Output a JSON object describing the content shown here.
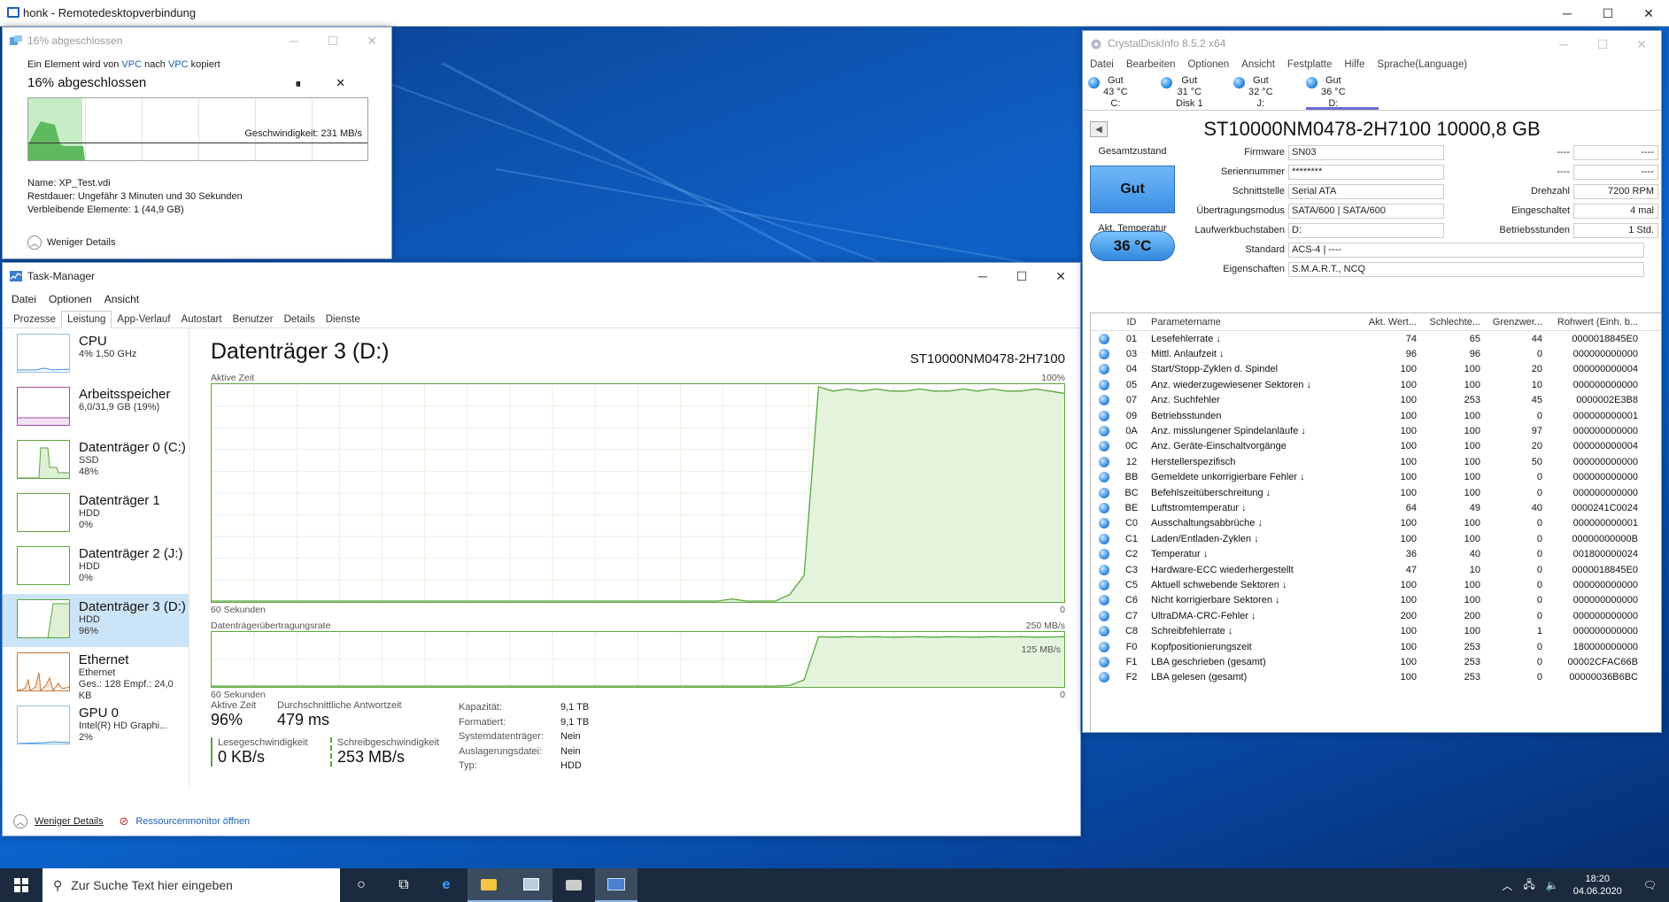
{
  "rdp": {
    "title": "honk - Remotedesktopverbindung"
  },
  "copy": {
    "title": "16% abgeschlossen",
    "line_prefix": "Ein Element wird von ",
    "src": "VPC",
    "mid": " nach ",
    "dst": "VPC",
    "suffix": " kopiert",
    "percent": "16% abgeschlossen",
    "speed": "Geschwindigkeit: 231 MB/s",
    "progress": 0.16,
    "name": "Name:  XP_Test.vdi",
    "remaining": "Restdauer:  Ungefähr 3 Minuten und 30 Sekunden",
    "items": "Verbleibende Elemente:  1 (44,9 GB)",
    "fewer": "Weniger Details"
  },
  "tm": {
    "title": "Task-Manager",
    "menu": [
      "Datei",
      "Optionen",
      "Ansicht"
    ],
    "tabs": [
      "Prozesse",
      "Leistung",
      "App-Verlauf",
      "Autostart",
      "Benutzer",
      "Details",
      "Dienste"
    ],
    "sidebar": [
      {
        "name": "CPU",
        "sub1": "4% 1,50 GHz",
        "sub2": "",
        "sub3": "",
        "color": "cpu"
      },
      {
        "name": "Arbeitsspeicher",
        "sub1": "6,0/31,9 GB (19%)",
        "sub2": "",
        "sub3": "",
        "color": "mem"
      },
      {
        "name": "Datenträger 0 (C:)",
        "sub1": "SSD",
        "sub2": "48%",
        "sub3": "",
        "color": "disk"
      },
      {
        "name": "Datenträger 1",
        "sub1": "HDD",
        "sub2": "0%",
        "sub3": "",
        "color": "disk"
      },
      {
        "name": "Datenträger 2 (J:)",
        "sub1": "HDD",
        "sub2": "0%",
        "sub3": "",
        "color": "disk"
      },
      {
        "name": "Datenträger 3 (D:)",
        "sub1": "HDD",
        "sub2": "96%",
        "sub3": "",
        "color": "disk"
      },
      {
        "name": "Ethernet",
        "sub1": "Ethernet",
        "sub2": "Ges.: 128 Empf.: 24,0 KB",
        "sub3": "",
        "color": "net"
      },
      {
        "name": "GPU 0",
        "sub1": "Intel(R) HD Graphi...",
        "sub2": "2%",
        "sub3": "",
        "color": "gpu"
      }
    ],
    "heading": "Datenträger 3 (D:)",
    "model": "ST10000NM0478-2H7100",
    "chart1": {
      "label": "Aktive Zeit",
      "max": "100%",
      "xl": "60 Sekunden",
      "xr": "0"
    },
    "chart2": {
      "label": "Datenträgerübertragungsrate",
      "max": "250 MB/s",
      "mid": "125 MB/s",
      "xl": "60 Sekunden",
      "xr": "0"
    },
    "active_time_series": [
      0,
      0,
      0,
      0,
      0,
      0,
      0,
      0,
      0,
      0,
      0,
      0,
      0,
      0,
      0,
      0,
      0,
      0,
      0,
      0,
      0,
      0,
      0,
      0,
      0,
      0,
      0,
      0,
      0,
      0,
      0,
      0,
      0,
      0,
      0,
      0,
      1,
      0,
      0,
      0,
      3,
      12,
      100,
      98,
      99,
      98,
      99,
      98,
      98,
      99,
      98,
      98,
      99,
      98,
      99,
      98,
      98,
      99,
      98,
      97
    ],
    "transfer_series": [
      0,
      0,
      0,
      0,
      0,
      0,
      0,
      0,
      0,
      0,
      0,
      0,
      0,
      0,
      0,
      0,
      0,
      0,
      0,
      0,
      0,
      0,
      0,
      0,
      0,
      0,
      0,
      0,
      0,
      0,
      0,
      0,
      0,
      0,
      0,
      0,
      0,
      0,
      0,
      0,
      3,
      30,
      240,
      238,
      240,
      239,
      240,
      238,
      239,
      240,
      238,
      240,
      239,
      238,
      240,
      239,
      240,
      238,
      239,
      240
    ],
    "stats": {
      "active_lbl": "Aktive Zeit",
      "active_val": "96%",
      "resp_lbl": "Durchschnittliche Antwortzeit",
      "resp_val": "479 ms",
      "read_lbl": "Lesegeschwindigkeit",
      "read_val": "0 KB/s",
      "write_lbl": "Schreibgeschwindigkeit",
      "write_val": "253 MB/s"
    },
    "kv": [
      {
        "k": "Kapazität:",
        "v": "9,1 TB"
      },
      {
        "k": "Formatiert:",
        "v": "9,1 TB"
      },
      {
        "k": "Systemdatenträger:",
        "v": "Nein"
      },
      {
        "k": "Auslagerungsdatei:",
        "v": "Nein"
      },
      {
        "k": "Typ:",
        "v": "HDD"
      }
    ],
    "fewer": "Weniger Details",
    "resmon": "Ressourcenmonitor öffnen"
  },
  "cdi": {
    "title": "CrystalDiskInfo 8.5.2 x64",
    "menu": [
      "Datei",
      "Bearbeiten",
      "Optionen",
      "Ansicht",
      "Festplatte",
      "Hilfe",
      "Sprache(Language)"
    ],
    "drives": [
      {
        "s": "Gut",
        "t": "43 °C",
        "d": "C:"
      },
      {
        "s": "Gut",
        "t": "31 °C",
        "d": "Disk 1"
      },
      {
        "s": "Gut",
        "t": "32 °C",
        "d": "J:"
      },
      {
        "s": "Gut",
        "t": "36 °C",
        "d": "D:"
      }
    ],
    "disk_title": "ST10000NM0478-2H7100 10000,8 GB",
    "health_lbl": "Gesamtzustand",
    "health": "Gut",
    "temp_lbl": "Akt. Temperatur",
    "temp": "36 °C",
    "props_left": [
      {
        "k": "Firmware",
        "v": "SN03"
      },
      {
        "k": "Seriennummer",
        "v": "********"
      },
      {
        "k": "Schnittstelle",
        "v": "Serial ATA"
      },
      {
        "k": "Übertragungsmodus",
        "v": "SATA/600 | SATA/600"
      },
      {
        "k": "Laufwerkbuchstaben",
        "v": "D:"
      }
    ],
    "props_right": [
      {
        "k": "----",
        "v": "----"
      },
      {
        "k": "----",
        "v": "----"
      },
      {
        "k": "Drehzahl",
        "v": "7200 RPM"
      },
      {
        "k": "Eingeschaltet",
        "v": "4 mal"
      },
      {
        "k": "Betriebsstunden",
        "v": "1 Std."
      }
    ],
    "standard_k": "Standard",
    "standard_v": "ACS-4 | ----",
    "features_k": "Eigenschaften",
    "features_v": "S.M.A.R.T., NCQ",
    "headers": [
      "ID",
      "Parametername",
      "Akt. Wert...",
      "Schlechte...",
      "Grenzwer...",
      "Rohwert (Einh. b..."
    ],
    "rows": [
      [
        "01",
        "Lesefehlerrate ↓",
        "74",
        "65",
        "44",
        "0000018845E0"
      ],
      [
        "03",
        "Mittl. Anlaufzeit ↓",
        "96",
        "96",
        "0",
        "000000000000"
      ],
      [
        "04",
        "Start/Stopp-Zyklen d. Spindel",
        "100",
        "100",
        "20",
        "000000000004"
      ],
      [
        "05",
        "Anz. wiederzugewiesener Sektoren ↓",
        "100",
        "100",
        "10",
        "000000000000"
      ],
      [
        "07",
        "Anz. Suchfehler",
        "100",
        "253",
        "45",
        "0000002E3B8"
      ],
      [
        "09",
        "Betriebsstunden",
        "100",
        "100",
        "0",
        "000000000001"
      ],
      [
        "0A",
        "Anz. misslungener Spindelanläufe ↓",
        "100",
        "100",
        "97",
        "000000000000"
      ],
      [
        "0C",
        "Anz. Geräte-Einschaltvorgänge",
        "100",
        "100",
        "20",
        "000000000004"
      ],
      [
        "12",
        "Herstellerspezifisch",
        "100",
        "100",
        "50",
        "000000000000"
      ],
      [
        "BB",
        "Gemeldete unkorrigierbare Fehler ↓",
        "100",
        "100",
        "0",
        "000000000000"
      ],
      [
        "BC",
        "Befehlszeitüberschreitung ↓",
        "100",
        "100",
        "0",
        "000000000000"
      ],
      [
        "BE",
        "Luftstromtemperatur ↓",
        "64",
        "49",
        "40",
        "0000241C0024"
      ],
      [
        "C0",
        "Ausschaltungsabbrüche ↓",
        "100",
        "100",
        "0",
        "000000000001"
      ],
      [
        "C1",
        "Laden/Entladen-Zyklen ↓",
        "100",
        "100",
        "0",
        "00000000000B"
      ],
      [
        "C2",
        "Temperatur ↓",
        "36",
        "40",
        "0",
        "001800000024"
      ],
      [
        "C3",
        "Hardware-ECC wiederhergestellt",
        "47",
        "10",
        "0",
        "0000018845E0"
      ],
      [
        "C5",
        "Aktuell schwebende Sektoren ↓",
        "100",
        "100",
        "0",
        "000000000000"
      ],
      [
        "C6",
        "Nicht korrigierbare Sektoren ↓",
        "100",
        "100",
        "0",
        "000000000000"
      ],
      [
        "C7",
        "UltraDMA-CRC-Fehler ↓",
        "200",
        "200",
        "0",
        "000000000000"
      ],
      [
        "C8",
        "Schreibfehlerrate ↓",
        "100",
        "100",
        "1",
        "000000000000"
      ],
      [
        "F0",
        "Kopfpositionierungszeit",
        "100",
        "253",
        "0",
        "180000000000"
      ],
      [
        "F1",
        "LBA geschrieben (gesamt)",
        "100",
        "253",
        "0",
        "00002CFAC66B"
      ],
      [
        "F2",
        "LBA gelesen (gesamt)",
        "100",
        "253",
        "0",
        "00000036B6BC"
      ]
    ]
  },
  "taskbar": {
    "search_placeholder": "Zur Suche Text hier eingeben",
    "time": "18:20",
    "date": "04.06.2020"
  }
}
